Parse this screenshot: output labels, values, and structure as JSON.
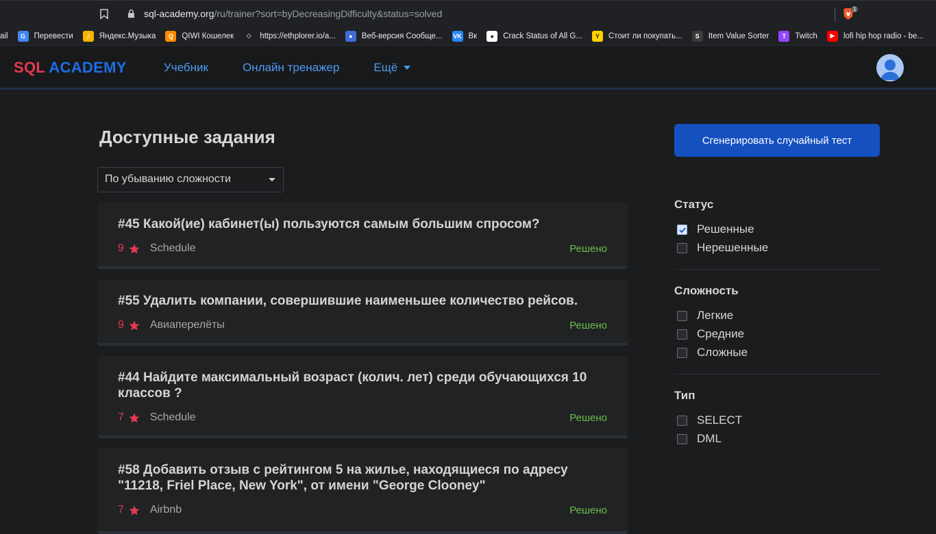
{
  "browser": {
    "url_host": "sql-academy.org",
    "url_path": "/ru/trainer?sort=byDecreasingDifficulty&status=solved",
    "extension_badge": "1",
    "bookmarks": [
      {
        "label": "ail",
        "color": "#202124",
        "glyph": ""
      },
      {
        "label": "Перевести",
        "color": "#4285f4",
        "glyph": "G"
      },
      {
        "label": "Яндекс.Музыка",
        "color": "#f5b400",
        "glyph": "♫"
      },
      {
        "label": "QIWI Кошелек",
        "color": "#ff8c00",
        "glyph": "Q"
      },
      {
        "label": "https://ethplorer.io/a...",
        "color": "#202124",
        "glyph": "◇"
      },
      {
        "label": "Веб-версия Сообще...",
        "color": "#3f6cd8",
        "glyph": "●"
      },
      {
        "label": "Вк",
        "color": "#2787f5",
        "glyph": "VK"
      },
      {
        "label": "Crack Status of All G...",
        "color": "#ffffff",
        "glyph": "●"
      },
      {
        "label": "Стоит ли покупать...",
        "color": "#ffd200",
        "glyph": "Y"
      },
      {
        "label": "Item Value Sorter",
        "color": "#3b3b3b",
        "glyph": "S"
      },
      {
        "label": "Twitch",
        "color": "#9146ff",
        "glyph": "T"
      },
      {
        "label": "lofi hip hop radio - be...",
        "color": "#ff0000",
        "glyph": "▶"
      }
    ]
  },
  "header": {
    "logo_sql": "SQL",
    "logo_academy": "ACADEMY",
    "nav": {
      "tutorial": "Учебник",
      "trainer": "Онлайн тренажер",
      "more": "Ещё"
    }
  },
  "main": {
    "title": "Доступные задания",
    "sort_value": "По убыванию сложности",
    "generate_button": "Сгенерировать случайный тест",
    "tasks": [
      {
        "title": "#45 Какой(ие) кабинет(ы) пользуются самым большим спросом?",
        "difficulty": "9",
        "database": "Schedule",
        "status": "Решено"
      },
      {
        "title": "#55 Удалить компании, совершившие наименьшее количество рейсов.",
        "difficulty": "9",
        "database": "Авиаперелёты",
        "status": "Решено"
      },
      {
        "title": "#44 Найдите максимальный возраст (колич. лет) среди обучающихся 10 классов ?",
        "difficulty": "7",
        "database": "Schedule",
        "status": "Решено"
      },
      {
        "title": "#58 Добавить отзыв с рейтингом 5 на жилье, находящиеся по адресу \"11218, Friel Place, New York\", от имени \"George Clooney\"",
        "difficulty": "7",
        "database": "Airbnb",
        "status": "Решено"
      }
    ]
  },
  "filters": {
    "status": {
      "heading": "Статус",
      "options": [
        {
          "label": "Решенные",
          "checked": true
        },
        {
          "label": "Нерешенные",
          "checked": false
        }
      ]
    },
    "difficulty": {
      "heading": "Сложность",
      "options": [
        {
          "label": "Легкие",
          "checked": false
        },
        {
          "label": "Средние",
          "checked": false
        },
        {
          "label": "Сложные",
          "checked": false
        }
      ]
    },
    "type": {
      "heading": "Тип",
      "options": [
        {
          "label": "SELECT",
          "checked": false
        },
        {
          "label": "DML",
          "checked": false
        }
      ]
    }
  },
  "colors": {
    "accent": "#1d6de5",
    "brand_red": "#e5394f",
    "solved_green": "#6abf4b",
    "button_blue": "#1550c0"
  }
}
